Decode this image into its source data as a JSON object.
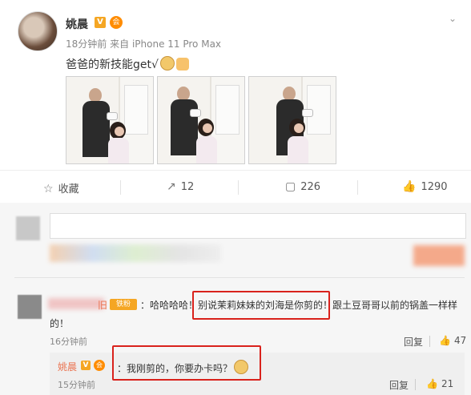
{
  "post": {
    "username": "姚晨",
    "verified_badge": "V",
    "vip_badge": "会",
    "time": "18分钟前",
    "source_prefix": "来自",
    "source": "iPhone 11 Pro Max",
    "text": "爸爸的新技能get√",
    "menu_icon": "chevron-down-icon",
    "photos_count": 3
  },
  "actions": {
    "favorite": {
      "icon": "star-icon",
      "label": "收藏"
    },
    "repost": {
      "icon": "share-icon",
      "label": "12"
    },
    "comment": {
      "icon": "comment-icon",
      "label": "226"
    },
    "like": {
      "icon": "thumbs-up-icon",
      "label": "1290"
    }
  },
  "comments": [
    {
      "name_tail": "旧",
      "badge": "铁粉",
      "text_before": "：哈哈哈哈！",
      "text_highlight": "别说茉莉妹妹的刘海是你剪的！",
      "text_after": "跟土豆哥哥以前的锅盖一样样",
      "text_line2": "的！",
      "time": "16分钟前",
      "reply_label": "回复",
      "likes": "47"
    }
  ],
  "sub_reply": {
    "username": "姚晨",
    "verified_badge": "V",
    "vip_badge": "会",
    "separator": "：",
    "text": "我刚剪的，你要办卡吗？",
    "time": "15分钟前",
    "reply_label": "回复",
    "likes": "21"
  },
  "colors": {
    "link_orange": "#eb7350",
    "badge_gold": "#f5a623",
    "highlight_red": "#d9221c"
  }
}
